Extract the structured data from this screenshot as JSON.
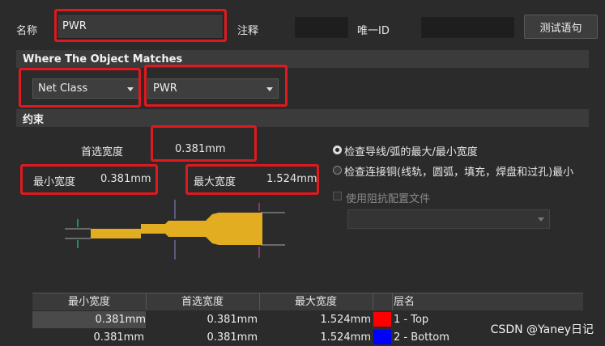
{
  "header": {
    "name_label": "名称",
    "name_value": "PWR",
    "comment_label": "注释",
    "comment_value": "",
    "uid_label": "唯一ID",
    "uid_value": "",
    "test_button": "测试语句"
  },
  "match": {
    "title": "Where The Object Matches",
    "type_value": "Net Class",
    "target_value": "PWR"
  },
  "constraints": {
    "title": "约束",
    "preferred_label": "首选宽度",
    "preferred_value": "0.381mm",
    "min_label": "最小宽度",
    "min_value": "0.381mm",
    "max_label": "最大宽度",
    "max_value": "1.524mm",
    "radio1_label": "检查导线/弧的最大/最小宽度",
    "radio2_label": "检查连接铜(线轨，圆弧，填充，焊盘和过孔)最小",
    "checkbox_label": "使用阻抗配置文件",
    "radio1_checked": true,
    "radio2_checked": false
  },
  "table": {
    "columns": [
      "最小宽度",
      "首选宽度",
      "最大宽度",
      "",
      "层名"
    ],
    "rows": [
      {
        "min": "0.381mm",
        "pref": "0.381mm",
        "max": "1.524mm",
        "color": "#ff0000",
        "layer": "1 - Top"
      },
      {
        "min": "0.381mm",
        "pref": "0.381mm",
        "max": "1.524mm",
        "color": "#0000ff",
        "layer": "2 - Bottom"
      }
    ]
  },
  "watermark": "CSDN @Yaney日记",
  "colors": {
    "trace": "#e3ad22",
    "highlight": "#e0191f"
  }
}
